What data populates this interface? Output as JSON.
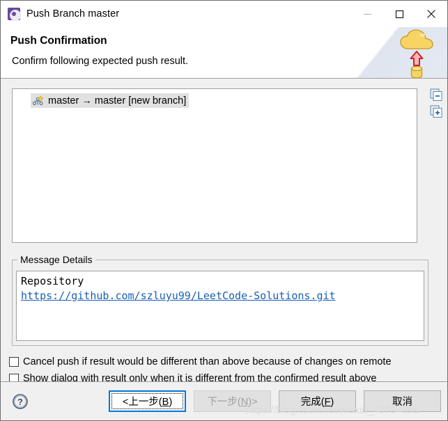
{
  "window": {
    "title": "Push Branch master",
    "icon": "push-branch-icon",
    "controls": {
      "minimize": "minimize-icon",
      "maximize": "maximize-icon",
      "close": "close-icon"
    }
  },
  "header": {
    "title": "Push Confirmation",
    "description": "Confirm following expected push result.",
    "graphic": "cloud-upload-icon"
  },
  "tree": {
    "items": [
      {
        "icon": "new-branch-icon",
        "label": "master → master [new branch]",
        "selected": true
      }
    ],
    "side_buttons": [
      {
        "name": "collapse-all-button",
        "icon": "collapse-all-icon"
      },
      {
        "name": "expand-all-button",
        "icon": "expand-all-icon"
      }
    ]
  },
  "message_details": {
    "legend": "Message Details",
    "heading": "Repository",
    "link": "https://github.com/szluyu99/LeetCode-Solutions.git"
  },
  "options": [
    {
      "label": "Cancel push if result would be different than above because of changes on remote",
      "checked": false
    },
    {
      "label": "Show dialog with result only when it is different from the confirmed result above",
      "checked": false
    }
  ],
  "footer": {
    "help": "help-icon",
    "buttons": [
      {
        "name": "back-button",
        "label": "<上一步(B)",
        "mnemonic": "B",
        "state": "focused"
      },
      {
        "name": "next-button",
        "label": "下一步(N)>",
        "mnemonic": "N",
        "state": "disabled"
      },
      {
        "name": "finish-button",
        "label": "完成(F)",
        "mnemonic": "F",
        "state": "normal"
      },
      {
        "name": "cancel-button",
        "label": "取消",
        "mnemonic": "",
        "state": "normal"
      }
    ]
  },
  "watermark": "https://blog.csdn.net/weixin_43734095",
  "colors": {
    "accent": "#0078d7",
    "link": "#1a5fb4",
    "dialog_bg": "#f0f0f0",
    "selection": "#e1e1e1",
    "cloud": "#f5cd5b",
    "arrow": "#d32020"
  }
}
